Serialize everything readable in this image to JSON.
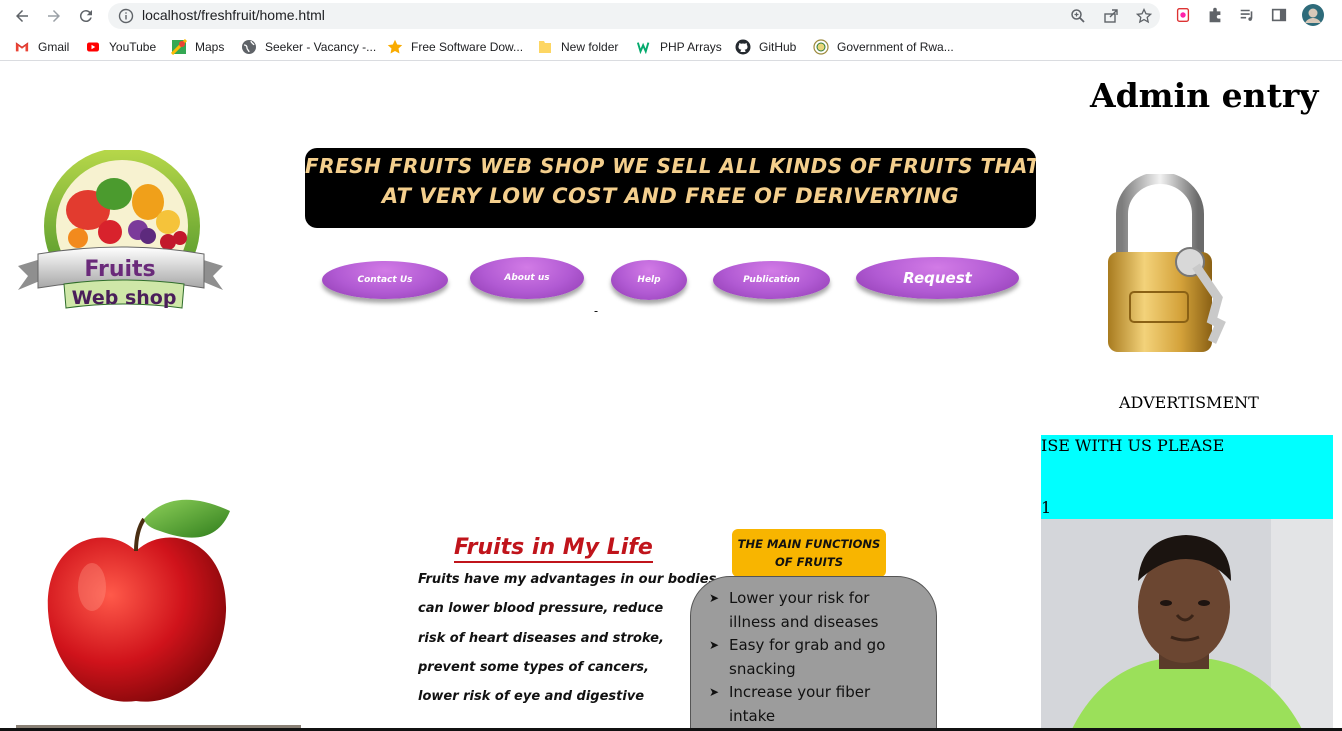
{
  "browser": {
    "url": "localhost/freshfruit/home.html",
    "bookmarks": [
      {
        "label": "Gmail",
        "icon": "gmail-icon"
      },
      {
        "label": "YouTube",
        "icon": "youtube-icon"
      },
      {
        "label": "Maps",
        "icon": "maps-icon"
      },
      {
        "label": "Seeker - Vacancy -...",
        "icon": "globe-icon"
      },
      {
        "label": "Free Software Dow...",
        "icon": "star-icon"
      },
      {
        "label": "New folder",
        "icon": "folder-icon"
      },
      {
        "label": "PHP Arrays",
        "icon": "w3-icon"
      },
      {
        "label": "GitHub",
        "icon": "github-icon"
      },
      {
        "label": "Government of Rwa...",
        "icon": "seal-icon"
      }
    ]
  },
  "header": {
    "admin_title": "Admin entry",
    "banner_line1": "FRESH FRUITS WEB SHOP WE SELL ALL KINDS OF FRUITS THAT YOU KNOW",
    "banner_line2": "AT VERY LOW COST AND FREE OF DERIVERYING",
    "logo_text1": "Fruits",
    "logo_text2": "Web shop"
  },
  "nav": {
    "contact": "Contact Us",
    "about": "About us",
    "help": "Help",
    "publication": "Publication",
    "request": "Request",
    "dash": "-"
  },
  "sidebar": {
    "advert_label": "ADVERTISMENT",
    "marquee_line1": "ISE WITH US PLEASE",
    "marquee_line2": "1"
  },
  "content": {
    "fruits_title": "Fruits in My Life",
    "fruits_lines": [
      "Fruits have my advantages in our bodies",
      "can lower blood pressure, reduce",
      "risk of heart diseases and stroke,",
      " prevent some types of cancers,",
      " lower risk of eye and digestive"
    ],
    "functions_heading_1": "THE MAIN FUNCTIONS",
    "functions_heading_2": "OF FRUITS",
    "functions": [
      {
        "l1": "Lower your risk for",
        "l2": "illness and diseases"
      },
      {
        "l1": "Easy for grab and go",
        "l2": "snacking"
      },
      {
        "l1": "Increase your fiber",
        "l2": "intake"
      }
    ]
  },
  "colors": {
    "pill": "#b15ad3",
    "marquee_bg": "#00ffff",
    "banner_text": "#f4cf8d",
    "title_red": "#c0141b",
    "functions_head": "#f8b500"
  }
}
